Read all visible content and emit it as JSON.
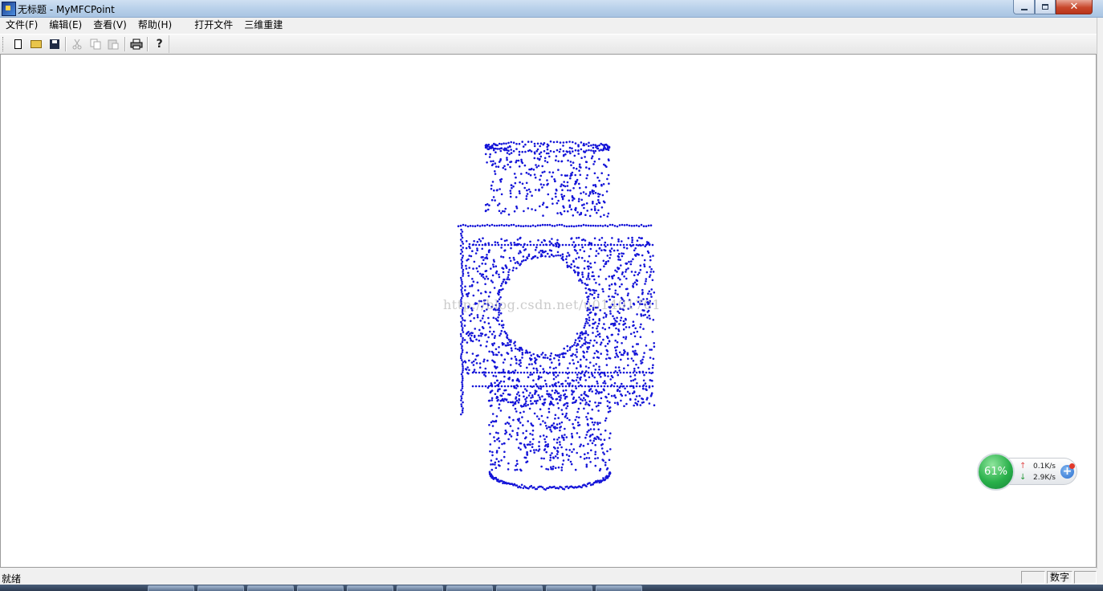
{
  "window": {
    "title": "无标题 - MyMFCPoint",
    "app_icon": "mfc-app-icon",
    "controls": [
      "minimize-icon",
      "restore-icon",
      "close-icon"
    ],
    "close_glyph": "✕"
  },
  "menu": {
    "items": [
      "文件(F)",
      "编辑(E)",
      "查看(V)",
      "帮助(H)"
    ],
    "extra_items": [
      "打开文件",
      "三维重建"
    ]
  },
  "toolbar": {
    "buttons": [
      {
        "name": "new-icon",
        "enabled": true
      },
      {
        "name": "open-icon",
        "enabled": true
      },
      {
        "name": "save-icon",
        "enabled": true
      },
      {
        "name": "cut-icon",
        "enabled": false
      },
      {
        "name": "copy-icon",
        "enabled": false
      },
      {
        "name": "paste-icon",
        "enabled": false
      },
      {
        "name": "print-icon",
        "enabled": true
      },
      {
        "name": "help-icon",
        "enabled": true
      }
    ],
    "help_glyph": "?"
  },
  "canvas": {
    "point_color": "#1515d8",
    "watermark": "http://blog.csdn.net/u01401701"
  },
  "net_monitor": {
    "percent": "61%",
    "upload": "0.1K/s",
    "download": "2.9K/s",
    "up_arrow": "↑",
    "down_arrow": "↓",
    "plus": "+"
  },
  "statusbar": {
    "text": "就绪",
    "num_indicator": "数字"
  },
  "colors": {
    "accent_close": "#c8472b",
    "net_green": "#29b04a",
    "point_blue": "#1515d8"
  }
}
